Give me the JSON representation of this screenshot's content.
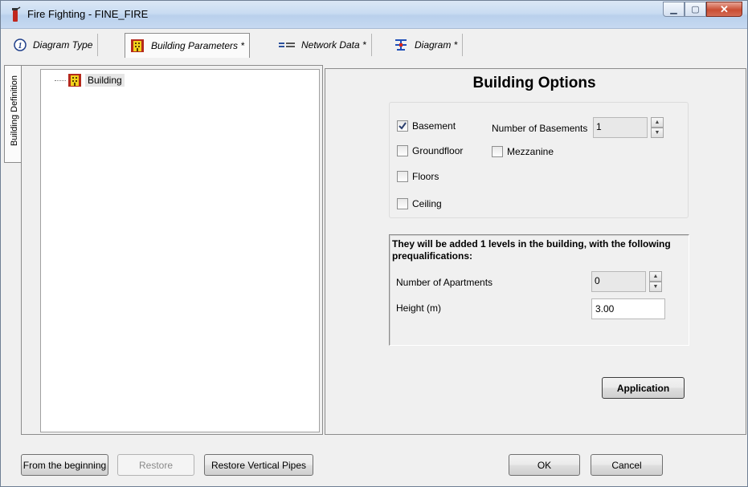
{
  "window": {
    "title": "Fire Fighting - FINE_FIRE"
  },
  "tabs": [
    {
      "label": "Diagram Type",
      "icon": "info-icon"
    },
    {
      "label": "Building Parameters *",
      "icon": "building-icon"
    },
    {
      "label": "Network Data *",
      "icon": "network-icon"
    },
    {
      "label": "Diagram *",
      "icon": "diagram-icon"
    }
  ],
  "side_tab": {
    "label": "Building Definition"
  },
  "tree": {
    "items": [
      {
        "label": "Building",
        "icon": "building-icon"
      }
    ]
  },
  "options": {
    "title": "Building Options",
    "basement": {
      "label": "Basement",
      "checked": true
    },
    "num_basements": {
      "label": "Number of Basements",
      "value": "1"
    },
    "groundfloor": {
      "label": "Groundfloor",
      "checked": false
    },
    "mezzanine": {
      "label": "Mezzanine",
      "checked": false
    },
    "floors": {
      "label": "Floors",
      "checked": false
    },
    "ceiling": {
      "label": "Ceiling",
      "checked": false
    }
  },
  "levels": {
    "info": "They will be added 1 levels in the building, with the following prequalifications:",
    "apartments": {
      "label": "Number of Apartments",
      "value": "0"
    },
    "height": {
      "label": "Height (m)",
      "value": "3.00"
    }
  },
  "buttons": {
    "application": "Application",
    "from_beginning": "From the beginning",
    "restore": "Restore",
    "restore_pipes": "Restore Vertical Pipes",
    "ok": "OK",
    "cancel": "Cancel"
  },
  "colors": {
    "titlebar": "#c9dcf2",
    "close": "#c94e33",
    "building_icon": "#f2d21c"
  }
}
